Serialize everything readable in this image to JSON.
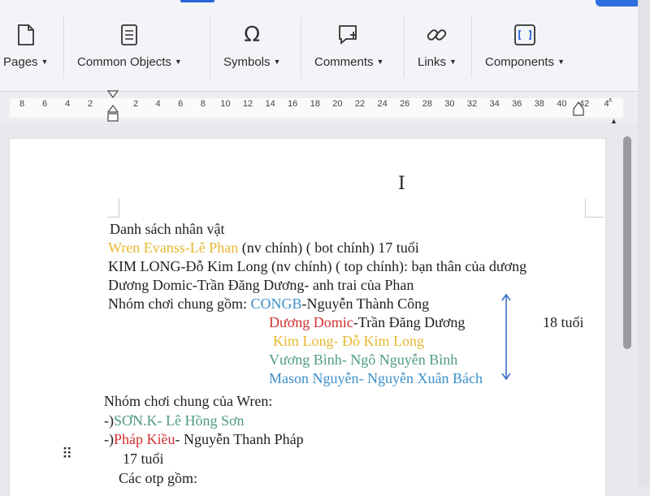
{
  "ribbon": {
    "groups": [
      {
        "label": "Pages",
        "icon": "page-icon"
      },
      {
        "label": "Common Objects",
        "icon": "list-doc-icon"
      },
      {
        "label": "Symbols",
        "icon": "omega-icon"
      },
      {
        "label": "Comments",
        "icon": "comment-add-icon"
      },
      {
        "label": "Links",
        "icon": "link-icon"
      },
      {
        "label": "Components",
        "icon": "component-icon"
      }
    ]
  },
  "ruler": {
    "left_ticks": [
      "8",
      "6",
      "4",
      "2"
    ],
    "right_ticks": [
      "2",
      "4",
      "6",
      "8",
      "10",
      "12",
      "14",
      "16",
      "18",
      "20",
      "22",
      "24",
      "26",
      "28",
      "30",
      "32",
      "34",
      "36",
      "38",
      "40",
      "42",
      "4"
    ]
  },
  "document": {
    "heading": "Danh sách nhân vật",
    "line1_name": "Wren Evanss-Lê Phan",
    "line1_rest": " (nv chính) ( bot chính) 17 tuổi",
    "line2": "KIM LONG-Đỗ Kim Long (nv chính) ( top chính): bạn thân của dương",
    "line3": "Dương Domic-Trần Đăng Dương- anh trai của Phan",
    "group_label": "Nhóm chơi chung gồm: ",
    "group_m1_a": "CONGB",
    "group_m1_b": "-Nguyễn Thành Công",
    "group_m2_a": "Dương Domic",
    "group_m2_b": "-Trần Đăng Dương",
    "age_note": "18 tuổi",
    "group_m3": "Kim Long- Đỗ Kim Long",
    "group_m4": "Vương Bình- Ngô Nguyễn Bình",
    "group_m5": "Mason Nguyễn- Nguyễn Xuân Bách",
    "wren_group_label": "Nhóm chơi chung của Wren:",
    "wren_m1_prefix": "-)",
    "wren_m1": "SƠN.K- Lê Hồng Sơn",
    "wren_m2_prefix": "-)",
    "wren_m2_a": "Pháp Kiều",
    "wren_m2_b": "- Nguyễn Thanh Pháp",
    "wren_age": "17 tuổi",
    "otp_label": "Các otp gồm:"
  },
  "colors": {
    "accent": "#2b65d9",
    "yellow_text": "#e7b82f",
    "red_text": "#d32f2f",
    "green_text": "#4f9a86",
    "blue_text": "#3b8fc9",
    "arrow": "#3a6fc4"
  }
}
